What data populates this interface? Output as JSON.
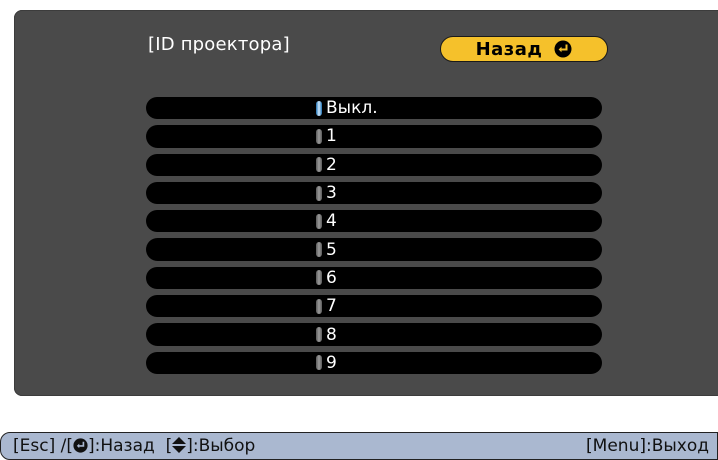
{
  "dialog": {
    "title": "[ID проектора]",
    "back_label": "Назад",
    "back_icon": "enter-icon"
  },
  "options": [
    {
      "label": "Выкл.",
      "selected": true
    },
    {
      "label": "1",
      "selected": false
    },
    {
      "label": "2",
      "selected": false
    },
    {
      "label": "3",
      "selected": false
    },
    {
      "label": "4",
      "selected": false
    },
    {
      "label": "5",
      "selected": false
    },
    {
      "label": "6",
      "selected": false
    },
    {
      "label": "7",
      "selected": false
    },
    {
      "label": "8",
      "selected": false
    },
    {
      "label": "9",
      "selected": false
    }
  ],
  "helpbar": {
    "left_prefix": "[Esc] /[",
    "left_enter_icon": "enter-icon",
    "left_suffix": "]:Назад  [",
    "left_updown_icon": "up-down-arrow-icon",
    "left_end": "]:Выбор",
    "right": "[Menu]:Выход"
  },
  "colors": {
    "panel": "#4a4a4a",
    "button": "#f5c12b",
    "row": "#000000",
    "helpbar": "#aab8d0",
    "selected_radio": "#1e6fb0"
  }
}
